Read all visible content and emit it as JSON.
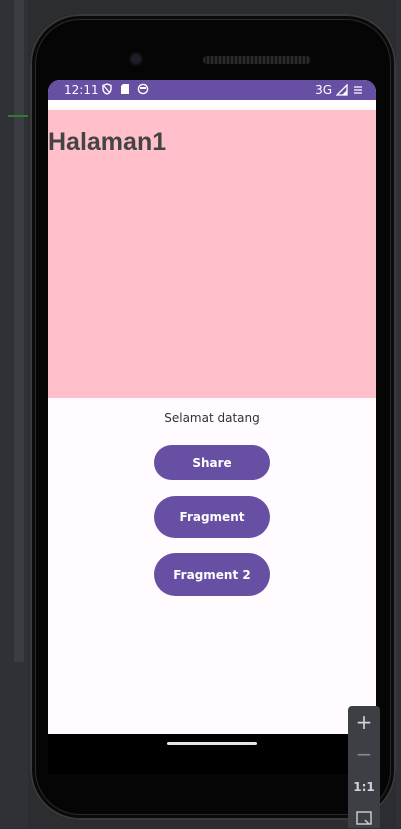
{
  "status_bar": {
    "time": "12:11",
    "network": "3G",
    "left_icons": [
      "vpn-shield-icon",
      "sd-card-icon",
      "face-icon"
    ],
    "right_icons": [
      "signal-icon",
      "data-icon"
    ]
  },
  "page": {
    "heading": "Halaman1",
    "welcome": "Selamat datang"
  },
  "buttons": {
    "share": "Share",
    "fragment": "Fragment",
    "fragment2": "Fragment 2"
  },
  "zoom_controls": {
    "zoom_in": "+",
    "zoom_out": "−",
    "actual_size": "1:1"
  },
  "colors": {
    "primary": "#6750a4",
    "header_background": "#ffc0cb",
    "screen_background": "#fffbfe"
  }
}
